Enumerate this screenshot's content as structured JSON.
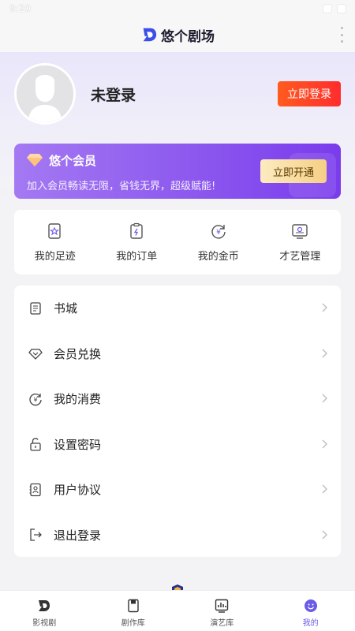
{
  "status_bar": {
    "time": "9:20"
  },
  "header": {
    "title": "悠个剧场"
  },
  "profile": {
    "login_status": "未登录",
    "login_button": "立即登录"
  },
  "vip": {
    "title": "悠个会员",
    "description": "加入会员畅读无限，省钱无界，超级赋能!",
    "button": "立即开通"
  },
  "quick_actions": [
    {
      "label": "我的足迹",
      "icon": "footprint-icon"
    },
    {
      "label": "我的订单",
      "icon": "order-icon"
    },
    {
      "label": "我的金币",
      "icon": "coin-icon"
    },
    {
      "label": "才艺管理",
      "icon": "talent-icon"
    }
  ],
  "menu": [
    {
      "label": "书城",
      "icon": "book-icon"
    },
    {
      "label": "会员兑换",
      "icon": "diamond-icon"
    },
    {
      "label": "我的消费",
      "icon": "consumption-icon"
    },
    {
      "label": "设置密码",
      "icon": "lock-icon"
    },
    {
      "label": "用户协议",
      "icon": "agreement-icon"
    },
    {
      "label": "退出登录",
      "icon": "logout-icon"
    }
  ],
  "bottom_nav": [
    {
      "label": "影视剧",
      "icon": "film-icon"
    },
    {
      "label": "剧作库",
      "icon": "script-icon"
    },
    {
      "label": "演艺库",
      "icon": "chart-icon"
    },
    {
      "label": "我的",
      "icon": "profile-icon",
      "active": true
    }
  ],
  "colors": {
    "accent": "#6b5ce7",
    "login_button": "#ff4a24",
    "vip_gradient_start": "#a479f2",
    "vip_gradient_end": "#7a3cec"
  }
}
